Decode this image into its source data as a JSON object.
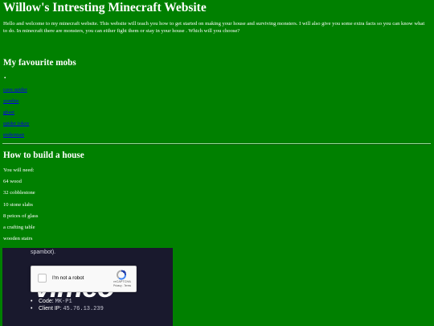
{
  "header": {
    "title": "Willow's Intresting Minecraft Website",
    "intro": "Hello and welcome to my minecraft website. This website will teach you how to get started on making your house and surviving monsters. I will also give you some extra facts so you can know what to do. In minecraft there are monsters, you can either fight them or stay in your house . Which will you choose?"
  },
  "mobs": {
    "heading": "My favourite mobs",
    "bullet": "•",
    "items": [
      "cave spider",
      "zombie",
      "ghast",
      "spider jokey",
      "enderman"
    ]
  },
  "house": {
    "heading": "How to build a house",
    "need_label": "You will need:",
    "materials": [
      "64 wood",
      "32 cobblestone",
      "10 stone slabs",
      "8 peices of glass",
      "a crafting table",
      "wooden stairs"
    ]
  },
  "embed": {
    "cut_text": "spambot).",
    "watermark": "vimeo",
    "code_label": "Code:",
    "code_value": "MK-P1",
    "client_ip_label": "Client IP:",
    "client_ip_value": "45.76.13.239",
    "captcha": {
      "label": "I'm not a robot",
      "brand": "reCAPTCHA",
      "terms": "Privacy - Terms"
    }
  },
  "colors": {
    "page_background": "#008000",
    "text": "#ffffff",
    "link": "#0000ee",
    "embed_background": "#19192d"
  },
  "icons": [
    "recaptcha-logo-icon",
    "checkbox-icon"
  ]
}
